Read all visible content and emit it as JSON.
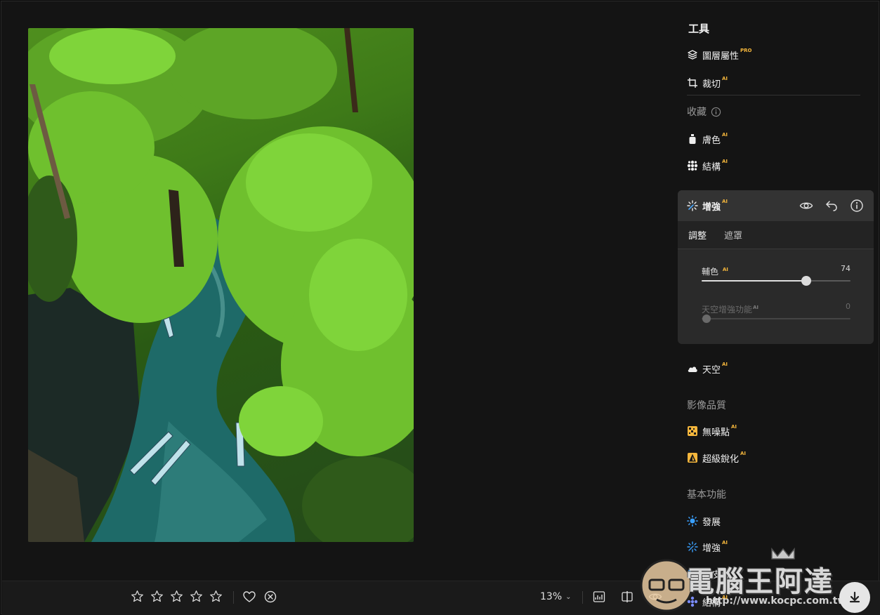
{
  "panel": {
    "title": "工具",
    "layers": {
      "label": "圖層屬性",
      "badge": "PRO"
    },
    "crop": {
      "label": "裁切",
      "badge": "AI"
    },
    "favorites_section": "收藏",
    "skin": {
      "label": "膚色",
      "badge": "AI"
    },
    "structure": {
      "label": "結構",
      "badge": "AI"
    },
    "enhance_card": {
      "title": "增強",
      "badge": "AI",
      "tabs": [
        "調整",
        "遮罩"
      ],
      "sliders": [
        {
          "label": "輔色",
          "badge": "AI",
          "value": "74",
          "fraction": 0.74,
          "enabled": true
        },
        {
          "label": "天空增強功能",
          "badge": "AI",
          "value": "0",
          "fraction": 0.0,
          "enabled": false
        }
      ]
    },
    "sky": {
      "label": "天空",
      "badge": "AI"
    },
    "quality_section": "影像品質",
    "denoise": {
      "label": "無噪點",
      "badge": "AI"
    },
    "sharpen": {
      "label": "超級銳化",
      "badge": "AI"
    },
    "basic_section": "基本功能",
    "develop": {
      "label": "發展"
    },
    "enhance2": {
      "label": "增強",
      "badge": "AI"
    },
    "landscape": {
      "label": "換皮膚"
    },
    "structure2": {
      "label": "結構",
      "badge": "AI"
    }
  },
  "toolbar": {
    "zoom": "13%",
    "rating_stars": 5
  },
  "watermark": {
    "title": "電腦王阿達",
    "url": "http://www.kocpc.com.tw"
  },
  "colors": {
    "accent_badge": "#f4b63c",
    "panel_bg": "#141414",
    "card_bg": "#2a2a2a"
  }
}
